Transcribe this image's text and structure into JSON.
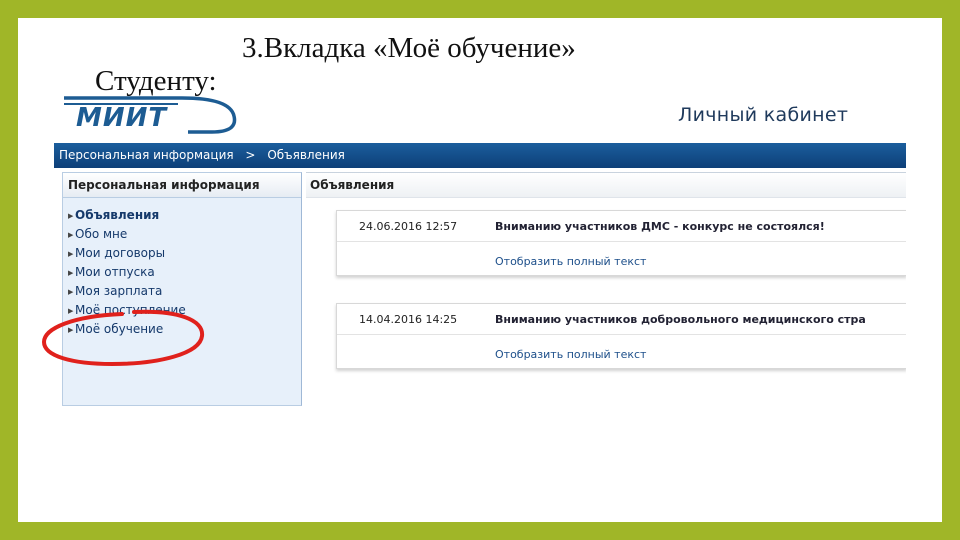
{
  "slide": {
    "title_prefix": "Студенту:",
    "title_main": "3.Вкладка «Моё обучение»",
    "frame_color": "#a0b628"
  },
  "header": {
    "logo_text": "МИИТ",
    "cabinet_title": "Личный кабинет"
  },
  "breadcrumb": {
    "items": [
      "Персональная информация",
      "Объявления"
    ],
    "separator": ">"
  },
  "sidebar": {
    "title": "Персональная информация",
    "items": [
      {
        "label": "Объявления",
        "active": true
      },
      {
        "label": "Обо мне"
      },
      {
        "label": "Мои договоры"
      },
      {
        "label": "Мои отпуска"
      },
      {
        "label": "Моя зарплата"
      },
      {
        "label": "Моё поступление"
      },
      {
        "label": "Моё обучение",
        "highlighted": true
      }
    ]
  },
  "main": {
    "title": "Объявления",
    "announcements": [
      {
        "date": "24.06.2016 12:57",
        "title": "Вниманию участников ДМС - конкурс не состоялся!",
        "link": "Отобразить полный текст"
      },
      {
        "date": "14.04.2016 14:25",
        "title": "Вниманию участников добровольного медицинского стра",
        "link": "Отобразить полный текст"
      }
    ]
  },
  "colors": {
    "nav_bar": "#0d3f78",
    "sidebar_bg": "#e7f0fa",
    "highlight_ring": "#e0211c",
    "brand_blue": "#1d5c93"
  }
}
